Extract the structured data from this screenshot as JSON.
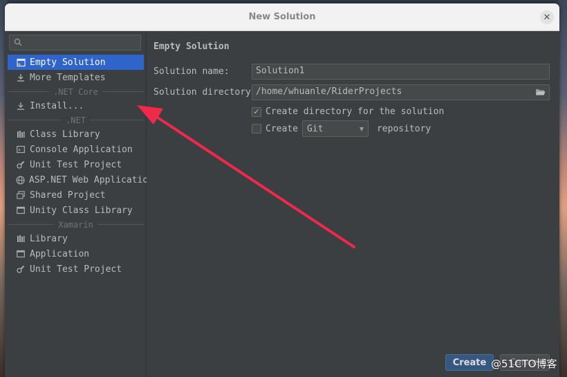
{
  "window": {
    "title": "New Solution"
  },
  "search": {
    "placeholder": "",
    "value": ""
  },
  "sidebar": {
    "items": [
      {
        "label": "Empty Solution",
        "icon": "empty-solution-icon"
      },
      {
        "label": "More Templates",
        "icon": "download-icon"
      },
      {
        "group": ".NET Core"
      },
      {
        "label": "Install...",
        "icon": "download-icon"
      },
      {
        "group": ".NET"
      },
      {
        "label": "Class Library",
        "icon": "library-icon"
      },
      {
        "label": "Console Application",
        "icon": "console-icon"
      },
      {
        "label": "Unit Test Project",
        "icon": "test-icon"
      },
      {
        "label": "ASP.NET Web Application",
        "icon": "globe-icon"
      },
      {
        "label": "Shared Project",
        "icon": "shared-icon"
      },
      {
        "label": "Unity Class Library",
        "icon": "window-icon"
      },
      {
        "group": "Xamarin"
      },
      {
        "label": "Library",
        "icon": "library-icon"
      },
      {
        "label": "Application",
        "icon": "window-icon"
      },
      {
        "label": "Unit Test Project",
        "icon": "test-icon"
      }
    ]
  },
  "main": {
    "heading": "Empty Solution",
    "solution_name_label": "Solution name:",
    "solution_name_value": "Solution1",
    "solution_dir_label": "Solution directory:",
    "solution_dir_value": "/home/whuanle/RiderProjects",
    "create_dir_label": "Create directory for the solution",
    "create_dir_checked": true,
    "create_repo_label": "Create",
    "create_repo_checked": false,
    "vcs_selected": "Git",
    "repository_label": "repository"
  },
  "buttons": {
    "create": "Create",
    "cancel": "Cancel"
  },
  "watermark": "@51CTO博客",
  "colors": {
    "selection": "#2f65ca",
    "annotation_arrow": "#f0284a",
    "create_button": "#365880"
  }
}
